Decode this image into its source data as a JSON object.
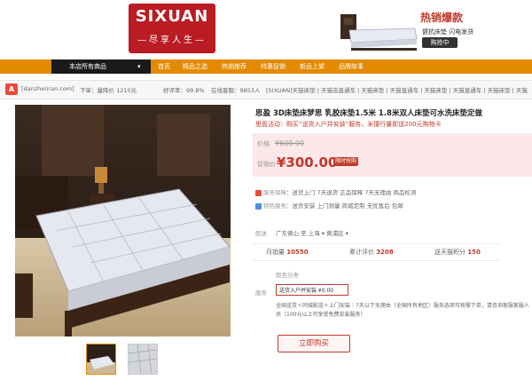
{
  "header": {
    "logo_text": "SIXUAN",
    "logo_sub": "—尽享人生—",
    "promo_title": "热销爆款",
    "promo_sub": "健抗床垫  闪电发货",
    "promo_button": "购抢中"
  },
  "nav": {
    "all_products": "本店所有商品",
    "items": [
      "首页",
      "精品之选",
      "热销推荐",
      "特惠促销",
      "新品上架",
      "品牌故事"
    ]
  },
  "shopbar": {
    "shop_url": "[danzhenran.com]",
    "segments": [
      "下单：量降价 1210元",
      "好评率：99.8%",
      "在线客服：9853人",
      "[SIXUAN]天猫床垫 | 天猫店直通车 | 天猫床垫 | 天猫直通车 | 天猫床垫 | 天猫直通车 | 天猫床垫 | 天猫直通车"
    ]
  },
  "product": {
    "title": "思盈 3D床垫床梦思 乳胶床垫1.5米 1.8米双人床垫可水洗床垫定做",
    "promo": "思盈活动：购买“送货入户并安装”服务，米撞行量即送200元购物卡",
    "orig_label": "价格",
    "orig_price": "¥600.00",
    "price_label": "促销价",
    "price": "¥300.00",
    "price_badge": "限时抢购",
    "services": [
      {
        "label": "服务保障",
        "text": "送货上门  7天退货  正品保障  7天无理由  商品检测"
      },
      {
        "label": "特色服务",
        "text": "送货安装  上门测量  商城定制  无忧售后  包邮"
      }
    ],
    "delivery_label": "配送",
    "delivery": "广东佛山  至 上海 ▾ 黄浦区 ▾",
    "stats": [
      {
        "label": "月销量",
        "value": "10550"
      },
      {
        "label": "累计评价",
        "value": "3208"
      },
      {
        "label": "送天猫积分",
        "value": "150"
      }
    ],
    "color_label": "颜色分类",
    "size_label": "服务",
    "size_option": "送货入户并安装  ¥0.00",
    "install_note": "全国送货＋同城配送＋上门安装｜7天以下无理由（全国所有地区）服务选项可按需下单，请咨询客服客服人员（100元以上可享受免费安装服务）",
    "buy_button": "立即购买"
  },
  "colors": {
    "brand_red": "#b91c22",
    "nav_orange": "#e38a00",
    "price_red": "#c0392b"
  }
}
